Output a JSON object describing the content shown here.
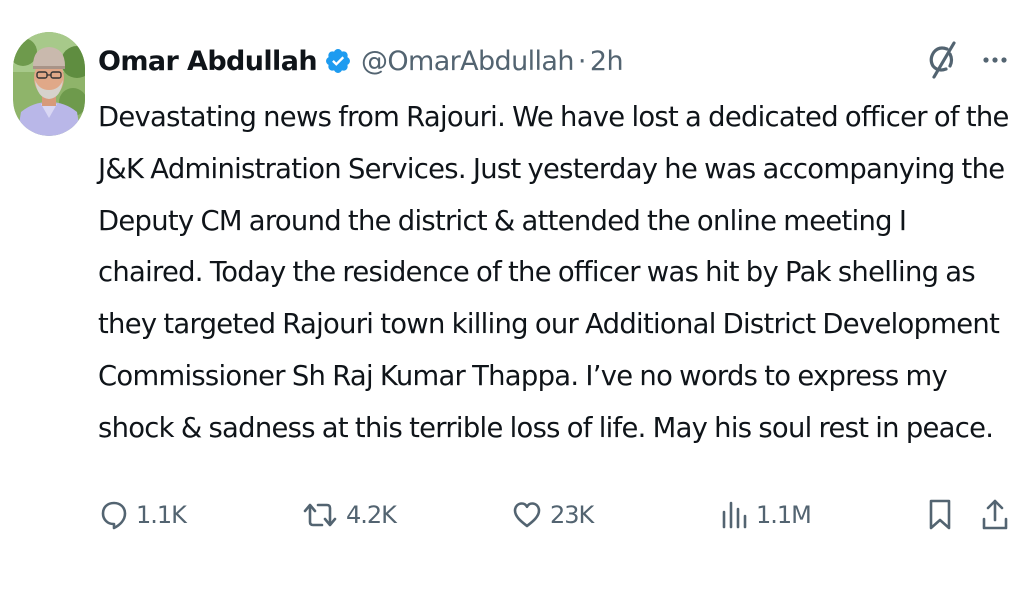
{
  "author": {
    "name": "Omar Abdullah",
    "handle": "@OmarAbdullah",
    "separator": "·",
    "time": "2h"
  },
  "tweet": {
    "text": "Devastating news from Rajouri. We have lost a dedicated officer of the J&K Administration Services. Just yesterday he was accompanying the Deputy CM around the district & attended the online meeting I chaired. Today the residence of the officer was hit by Pak shelling as they targeted Rajouri town killing our Additional District Development Commissioner Sh Raj Kumar Thappa. I’ve no words to express my shock & sadness at this terrible loss of life. May his soul rest in peace."
  },
  "actions": {
    "replies": "1.1K",
    "reposts": "4.2K",
    "likes": "23K",
    "views": "1.1M"
  },
  "icons": {
    "verified": "verified-badge-icon",
    "grok": "grok-icon",
    "more": "more-icon",
    "reply": "reply-icon",
    "repost": "repost-icon",
    "like": "like-icon",
    "views": "views-icon",
    "bookmark": "bookmark-icon",
    "share": "share-icon"
  },
  "colors": {
    "text": "#0f1419",
    "secondary": "#536471",
    "verified": "#1d9bf0",
    "background": "#ffffff"
  }
}
